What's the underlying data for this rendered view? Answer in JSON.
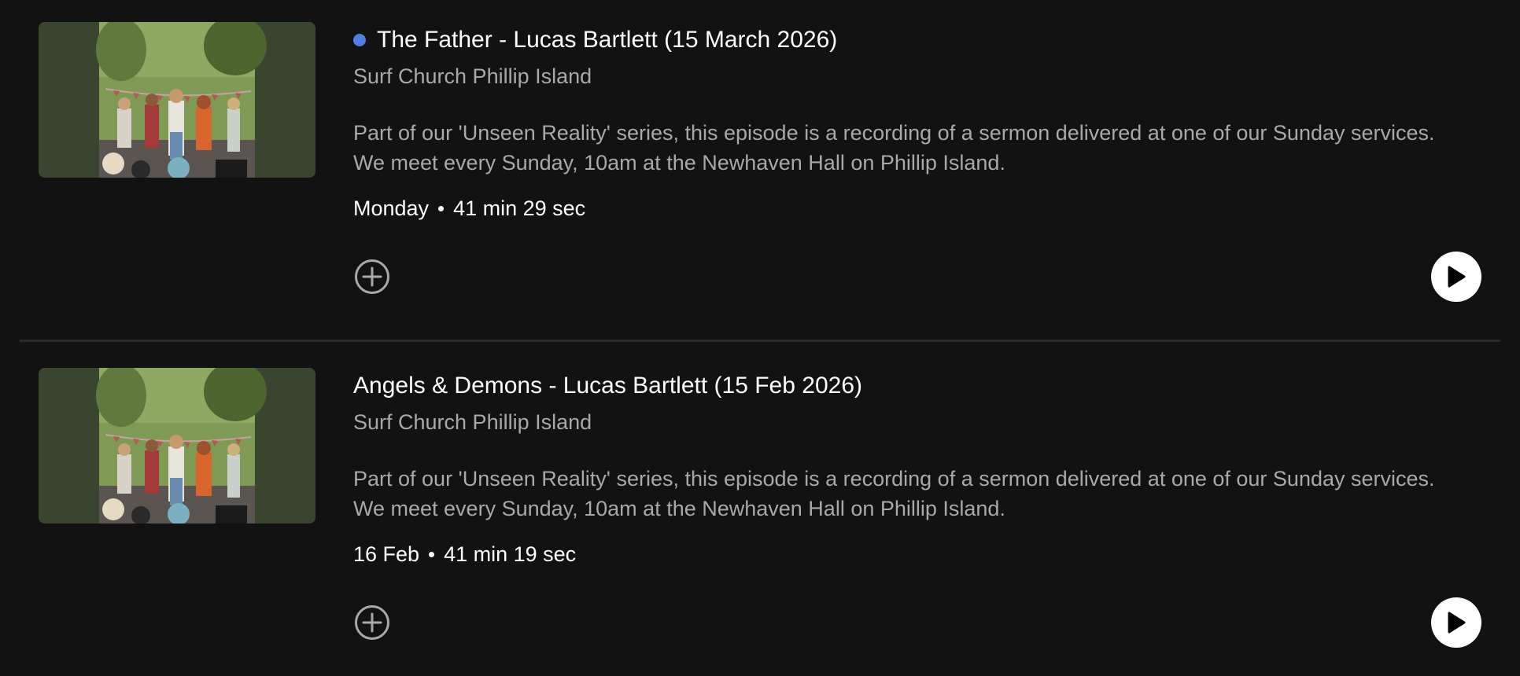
{
  "colors": {
    "background": "#121212",
    "new_indicator": "#4f7fe0",
    "secondary_text": "#a9a9a9",
    "divider": "#2a2a2a"
  },
  "episodes": [
    {
      "is_new": true,
      "title": "The Father - Lucas Bartlett (15 March 2026)",
      "show": "Surf Church Phillip Island",
      "description_lines": [
        "Part of our 'Unseen Reality' series, this episode is a recording of a sermon delivered at one of our Sunday services.",
        "We meet every Sunday, 10am at the Newhaven Hall on Phillip Island."
      ],
      "date": "Monday",
      "duration": "41 min 29 sec",
      "add_icon": "plus-circle-icon",
      "play_icon": "play-icon"
    },
    {
      "is_new": false,
      "title": "Angels & Demons - Lucas Bartlett (15 Feb 2026)",
      "show": "Surf Church Phillip Island",
      "description_lines": [
        "Part of our 'Unseen Reality' series, this episode is a recording of a sermon delivered at one of our Sunday services.",
        "We meet every Sunday, 10am at the Newhaven Hall on Phillip Island."
      ],
      "date": "16 Feb",
      "duration": "41 min 19 sec",
      "add_icon": "plus-circle-icon",
      "play_icon": "play-icon"
    }
  ]
}
